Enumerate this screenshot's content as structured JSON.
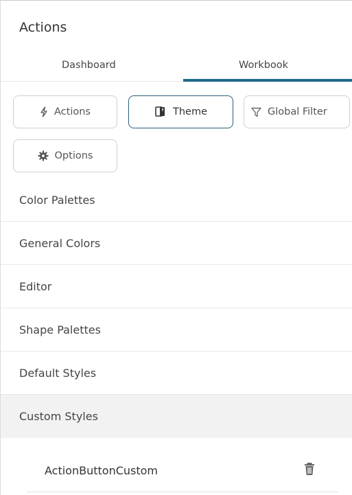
{
  "panel": {
    "title": "Actions"
  },
  "tabs": [
    {
      "label": "Dashboard",
      "active": false
    },
    {
      "label": "Workbook",
      "active": true
    }
  ],
  "chips": {
    "actions": {
      "label": "Actions",
      "icon": "lightning-icon"
    },
    "theme": {
      "label": "Theme",
      "icon": "theme-icon",
      "active": true
    },
    "global_filter": {
      "label": "Global Filter",
      "icon": "filter-icon"
    },
    "options": {
      "label": "Options",
      "icon": "gear-icon"
    }
  },
  "sections": [
    {
      "label": "Color Palettes"
    },
    {
      "label": "General Colors"
    },
    {
      "label": "Editor"
    },
    {
      "label": "Shape Palettes"
    },
    {
      "label": "Default Styles"
    },
    {
      "label": "Custom Styles",
      "selected": true
    }
  ],
  "custom_styles": {
    "items": [
      {
        "label": "ActionButtonCustom",
        "icon": "trash-icon"
      }
    ]
  },
  "colors": {
    "accent": "#1e6a8a",
    "active_border": "#2a5f7a",
    "selected_row_bg": "#f2f2f2",
    "divider": "#e7e7e7"
  }
}
